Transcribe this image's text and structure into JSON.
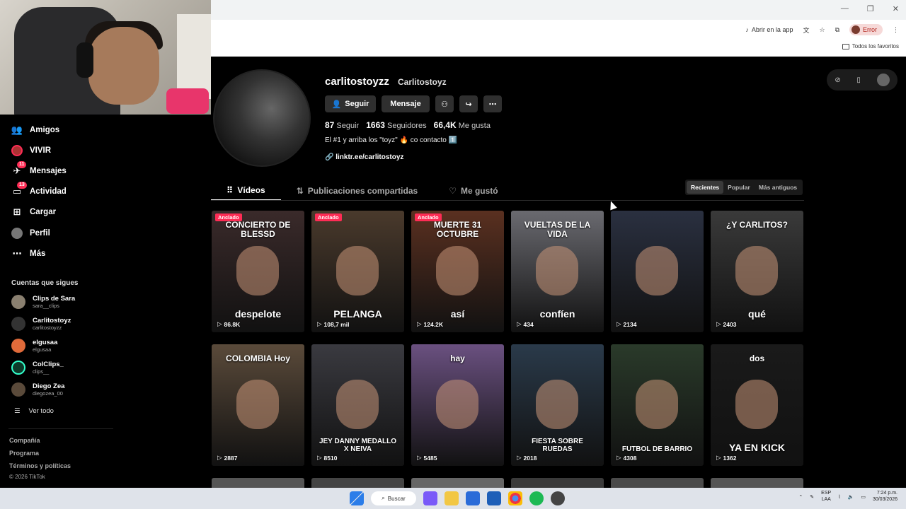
{
  "browser": {
    "open_in_app": "Abrir en la app",
    "profile_error": "Error",
    "bookmarks_all": "Todos los favoritos"
  },
  "sidebar": {
    "items": [
      {
        "label": "Amigos",
        "icon": "friends-icon"
      },
      {
        "label": "VIVIR",
        "icon": "live-icon"
      },
      {
        "label": "Mensajes",
        "icon": "messages-icon",
        "badge": "11"
      },
      {
        "label": "Actividad",
        "icon": "activity-icon",
        "badge": "13"
      },
      {
        "label": "Cargar",
        "icon": "upload-icon"
      },
      {
        "label": "Perfil",
        "icon": "profile-icon"
      },
      {
        "label": "Más",
        "icon": "more-icon"
      }
    ],
    "following_heading": "Cuentas que sigues",
    "following": [
      {
        "name": "Clips de Sara",
        "handle": "sara__clips"
      },
      {
        "name": "Carlitostoyz",
        "handle": "carlitostoyzz"
      },
      {
        "name": "elgusaa",
        "handle": "elgusaa"
      },
      {
        "name": "ColClips_",
        "handle": "clips__"
      },
      {
        "name": "Diego Zea",
        "handle": "diegozea_00"
      }
    ],
    "see_all": "Ver todo",
    "footer": [
      "Compañía",
      "Programa",
      "Términos y políticas",
      "© 2026 TikTok"
    ]
  },
  "profile": {
    "username": "carlitostoyzz",
    "nickname": "Carlitostoyz",
    "follow_label": "Seguir",
    "message_label": "Mensaje",
    "stats": [
      {
        "value": "87",
        "label": "Seguir"
      },
      {
        "value": "1663",
        "label": "Seguidores"
      },
      {
        "value": "66,4K",
        "label": "Me gusta"
      }
    ],
    "bio": "El #1 y arriba los \"toyz\" 🔥 co contacto 1️⃣",
    "link": "linktr.ee/carlitostoyz"
  },
  "tabs": [
    {
      "label": "Vídeos",
      "active": true
    },
    {
      "label": "Publicaciones compartidas",
      "active": false
    },
    {
      "label": "Me gustó",
      "active": false
    }
  ],
  "sort": [
    "Recientes",
    "Popular",
    "Más antiguos"
  ],
  "pinned_label": "Anclado",
  "videos": [
    {
      "caption": "CONCIERTO DE BLESSD",
      "subcaption": "despelote",
      "views": "86.8K",
      "pinned": true,
      "bg": "#3a2a2a"
    },
    {
      "caption": "",
      "subcaption": "PELANGA",
      "views": "108,7 mil",
      "pinned": true,
      "bg": "#4a3a2c"
    },
    {
      "caption": "MUERTE 31 OCTUBRE",
      "subcaption": "así",
      "views": "124.2K",
      "pinned": true,
      "bg": "#5a3020"
    },
    {
      "caption": "VUELTAS DE LA VIDA",
      "subcaption": "confíen",
      "views": "434",
      "pinned": false,
      "bg": "#6a6a70"
    },
    {
      "caption": "",
      "subcaption": "",
      "views": "2134",
      "pinned": false,
      "bg": "#2a3040"
    },
    {
      "caption": "¿Y CARLITOS?",
      "subcaption": "qué",
      "views": "2403",
      "pinned": false,
      "bg": "#3a3a3a"
    },
    {
      "caption": "COLOMBIA Hoy",
      "subcaption": "",
      "views": "2887",
      "pinned": false,
      "bg": "#5a4a3a"
    },
    {
      "caption": "",
      "subcaption": "JEY DANNY MEDALLO X NEIVA",
      "views": "8510",
      "pinned": false,
      "bg": "#3a3a40"
    },
    {
      "caption": "hay",
      "subcaption": "",
      "views": "5485",
      "pinned": false,
      "bg": "#6a5080"
    },
    {
      "caption": "",
      "subcaption": "FIESTA SOBRE RUEDAS",
      "views": "2018",
      "pinned": false,
      "bg": "#2a3a4a"
    },
    {
      "caption": "",
      "subcaption": "FUTBOL DE BARRIO",
      "views": "4308",
      "pinned": false,
      "bg": "#2a3a2a"
    },
    {
      "caption": "dos",
      "subcaption": "YA EN KICK",
      "views": "1362",
      "pinned": false,
      "bg": "#1a1a1a"
    }
  ],
  "taskbar": {
    "search_label": "Buscar",
    "lang": "ESP",
    "region": "LAA",
    "time": "7:24 p.m.",
    "date": "30/03/2026"
  }
}
